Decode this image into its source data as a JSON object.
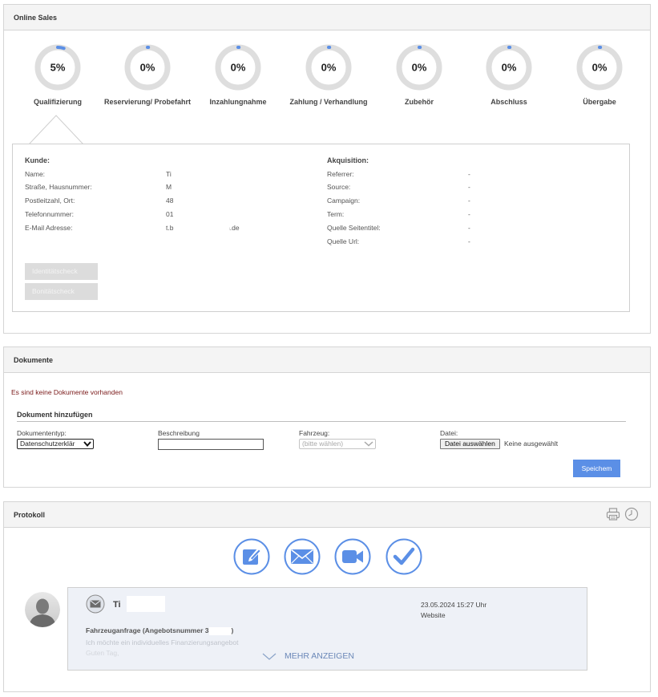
{
  "sales": {
    "title": "Online Sales",
    "steps": [
      {
        "label": "Qualifizierung",
        "percent": 5,
        "display": "5%"
      },
      {
        "label": "Reservierung/ Probefahrt",
        "percent": 0,
        "display": "0%"
      },
      {
        "label": "Inzahlungnahme",
        "percent": 0,
        "display": "0%"
      },
      {
        "label": "Zahlung / Verhandlung",
        "percent": 0,
        "display": "0%"
      },
      {
        "label": "Zubehör",
        "percent": 0,
        "display": "0%"
      },
      {
        "label": "Abschluss",
        "percent": 0,
        "display": "0%"
      },
      {
        "label": "Übergabe",
        "percent": 0,
        "display": "0%"
      }
    ],
    "customer": {
      "heading": "Kunde:",
      "rows": [
        {
          "key": "Name:",
          "value": "Ti"
        },
        {
          "key": "Straße, Hausnummer:",
          "value": "M"
        },
        {
          "key": "Postleitzahl, Ort:",
          "value": "48"
        },
        {
          "key": "Telefonnummer:",
          "value": "01"
        },
        {
          "key": "E-Mail Adresse:",
          "value": "t.b",
          "value_tail": "n.de"
        }
      ]
    },
    "acquisition": {
      "heading": "Akquisition:",
      "rows": [
        {
          "key": "Referrer:",
          "value": "-"
        },
        {
          "key": "Source:",
          "value": "-"
        },
        {
          "key": "Campaign:",
          "value": "-"
        },
        {
          "key": "Term:",
          "value": "-"
        },
        {
          "key": "Quelle Seitentitel:",
          "value": "-"
        },
        {
          "key": "Quelle Url:",
          "value": "-"
        }
      ]
    },
    "identity_button": "Identitätscheck",
    "credit_button": "Bonitätscheck"
  },
  "documents": {
    "title": "Dokumente",
    "empty_message": "Es sind keine Dokumente vorhanden",
    "add_title": "Dokument hinzufügen",
    "type_label": "Dokumententyp:",
    "type_value": "Datenschutzerklär",
    "desc_label": "Beschreibung",
    "vehicle_label": "Fahrzeug:",
    "vehicle_value": "(bitte wählen)",
    "file_label": "Datei:",
    "file_button": "Datei auswählen",
    "file_none": "Keine ausgewählt",
    "save_button": "Speichem"
  },
  "protocol": {
    "title": "Protokoll",
    "header_icons": [
      "printer-icon",
      "clock-icon"
    ],
    "actions": [
      "note-edit-icon",
      "envelope-icon",
      "video-camera-icon",
      "checkmark-icon"
    ],
    "entry": {
      "name": "Ti",
      "date": "23.05.2024 15:27 Uhr",
      "source": "Website",
      "subject_start": "Fahrzeuganfrage (Angebotsnummer 3",
      "subject_end": ")",
      "body_line1": "Ich möchte ein individuelles Finanzierungsangebot",
      "body_line2": "Guten Tag,"
    },
    "more_label": "MEHR ANZEIGEN"
  },
  "colors": {
    "accent": "#5b8fe6",
    "ring_track": "#dedede",
    "ring_progress": "#5b8fe6"
  }
}
